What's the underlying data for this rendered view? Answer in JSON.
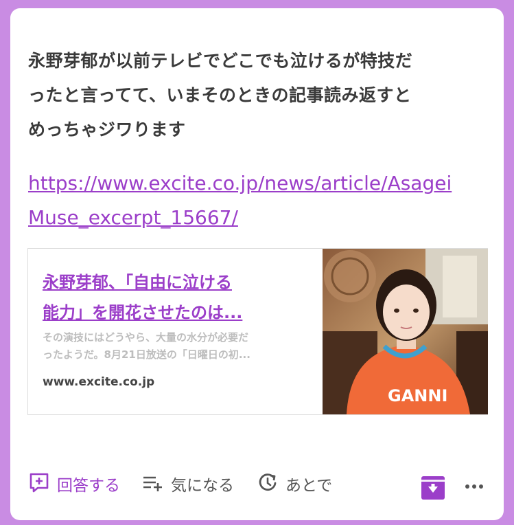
{
  "post": {
    "text_lines": [
      "永野芽郁が以前テレビでどこでも泣けるが特技だ",
      "ったと言ってて、いまそのときの記事読み返すと",
      "めっちゃジワります"
    ],
    "link_lines": [
      "https://www.excite.co.jp/news/article/Asagei",
      "Muse_excerpt_15667/"
    ]
  },
  "preview": {
    "title_lines": [
      "永野芽郁、「自由に泣ける",
      "能力」を開花させたのは..."
    ],
    "desc_lines": [
      "その演技にはどうやら、大量の水分が必要だ",
      "ったようだ。8月21日放送の「日曜日の初..."
    ],
    "domain": "www.excite.co.jp",
    "image_shirt_text": "GANNI"
  },
  "actions": {
    "answer_label": "回答する",
    "interest_label": "気になる",
    "later_label": "あとで"
  },
  "icons": {
    "answer": "add-box-icon",
    "interest": "playlist-add-icon",
    "later": "history-icon",
    "archive": "archive-down-icon",
    "more": "more-dots-icon"
  },
  "colors": {
    "background": "#c98ce3",
    "accent": "#9b3ec9",
    "text": "#3a3a3a"
  }
}
